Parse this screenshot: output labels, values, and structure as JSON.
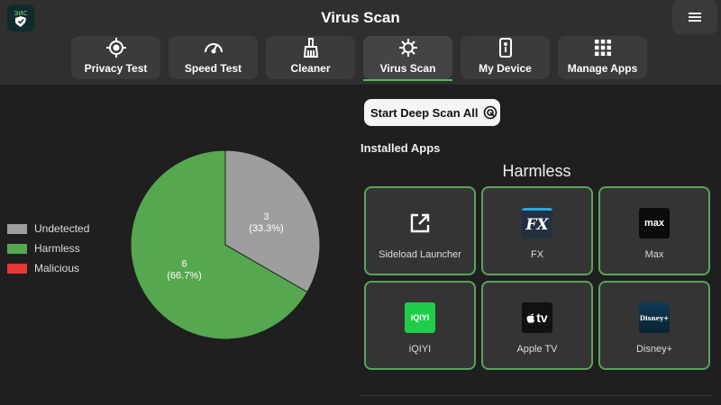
{
  "header": {
    "title": "Virus Scan",
    "logo_text": "ЭИС"
  },
  "tabs": [
    {
      "label": "Privacy Test",
      "icon": "crosshair-icon",
      "active": false
    },
    {
      "label": "Speed Test",
      "icon": "speedometer-icon",
      "active": false
    },
    {
      "label": "Cleaner",
      "icon": "broom-icon",
      "active": false
    },
    {
      "label": "Virus Scan",
      "icon": "virus-icon",
      "active": true
    },
    {
      "label": "My Device",
      "icon": "phone-info-icon",
      "active": false
    },
    {
      "label": "Manage Apps",
      "icon": "grid-icon",
      "active": false
    }
  ],
  "actions": {
    "deep_scan_label": "Start Deep Scan All"
  },
  "section": {
    "installed_label": "Installed Apps",
    "group_label": "Harmless"
  },
  "apps": [
    {
      "name": "Sideload Launcher",
      "icon": "external-link-icon"
    },
    {
      "name": "FX",
      "icon": "fx-logo-icon",
      "icon_text": "FX"
    },
    {
      "name": "Max",
      "icon": "max-logo-icon",
      "icon_text": "max"
    },
    {
      "name": "iQIYI",
      "icon": "iqiyi-logo-icon",
      "icon_text": "iQIYI"
    },
    {
      "name": "Apple TV",
      "icon": "apple-tv-logo-icon",
      "icon_text": "tv"
    },
    {
      "name": "Disney+",
      "icon": "disney-plus-logo-icon",
      "icon_text": "Disney+"
    }
  ],
  "colors": {
    "undetected": "#9e9e9e",
    "harmless": "#55a84f",
    "malicious": "#e53935",
    "accent": "#59b55b"
  },
  "chart_data": {
    "type": "pie",
    "slices": [
      {
        "label": "Undetected",
        "value": 3,
        "percent_label": "(33.3%)",
        "color": "#9e9e9e"
      },
      {
        "label": "Harmless",
        "value": 6,
        "percent_label": "(66.7%)",
        "color": "#55a84f"
      },
      {
        "label": "Malicious",
        "value": 0,
        "percent_label": "",
        "color": "#e53935"
      }
    ],
    "legend_position": "left"
  }
}
